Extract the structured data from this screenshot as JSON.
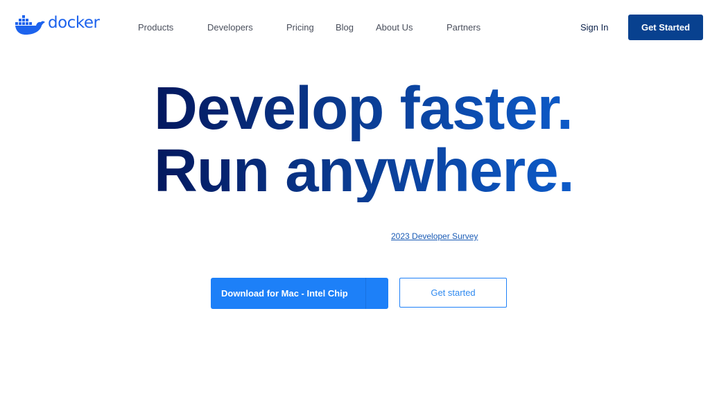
{
  "brand": {
    "name": "docker",
    "color": "#1d63ed",
    "logo_icon": "docker-whale-icon"
  },
  "nav": {
    "items": [
      {
        "label": "Products"
      },
      {
        "label": "Developers"
      },
      {
        "label": "Pricing"
      },
      {
        "label": "Blog"
      },
      {
        "label": "About Us"
      },
      {
        "label": "Partners"
      }
    ],
    "sign_in": "Sign In",
    "get_started": "Get Started"
  },
  "hero": {
    "line1": "Develop faster.",
    "line2": "Run anywhere.",
    "survey_link": "2023 Developer Survey"
  },
  "actions": {
    "download_label": "Download for Mac - Intel Chip",
    "get_started_label": "Get started"
  },
  "colors": {
    "primary_dark": "#08418f",
    "primary_blue": "#1d80f8",
    "nav_text": "#4a4f5c"
  }
}
